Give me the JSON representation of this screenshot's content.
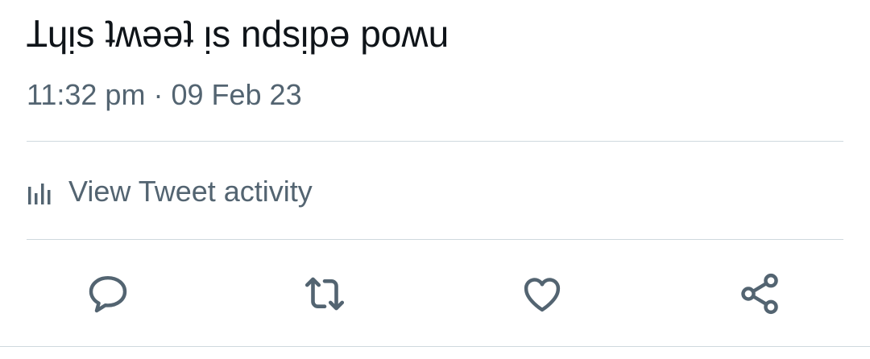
{
  "tweet": {
    "text": "Ʇɥᴉs ʇʍǝǝʇ ᴉs ndsᴉpǝ poʍu",
    "time": "11:32 pm",
    "separator": "·",
    "date": "09 Feb 23"
  },
  "activity": {
    "label": "View Tweet activity",
    "icon": "bar-chart-icon"
  },
  "actions": [
    {
      "name": "reply",
      "icon": "reply-icon"
    },
    {
      "name": "retweet",
      "icon": "retweet-icon"
    },
    {
      "name": "like",
      "icon": "heart-icon"
    },
    {
      "name": "share",
      "icon": "share-icon"
    }
  ],
  "colors": {
    "text_primary": "#0f1419",
    "text_secondary": "#536471",
    "divider": "#cfd9de"
  }
}
